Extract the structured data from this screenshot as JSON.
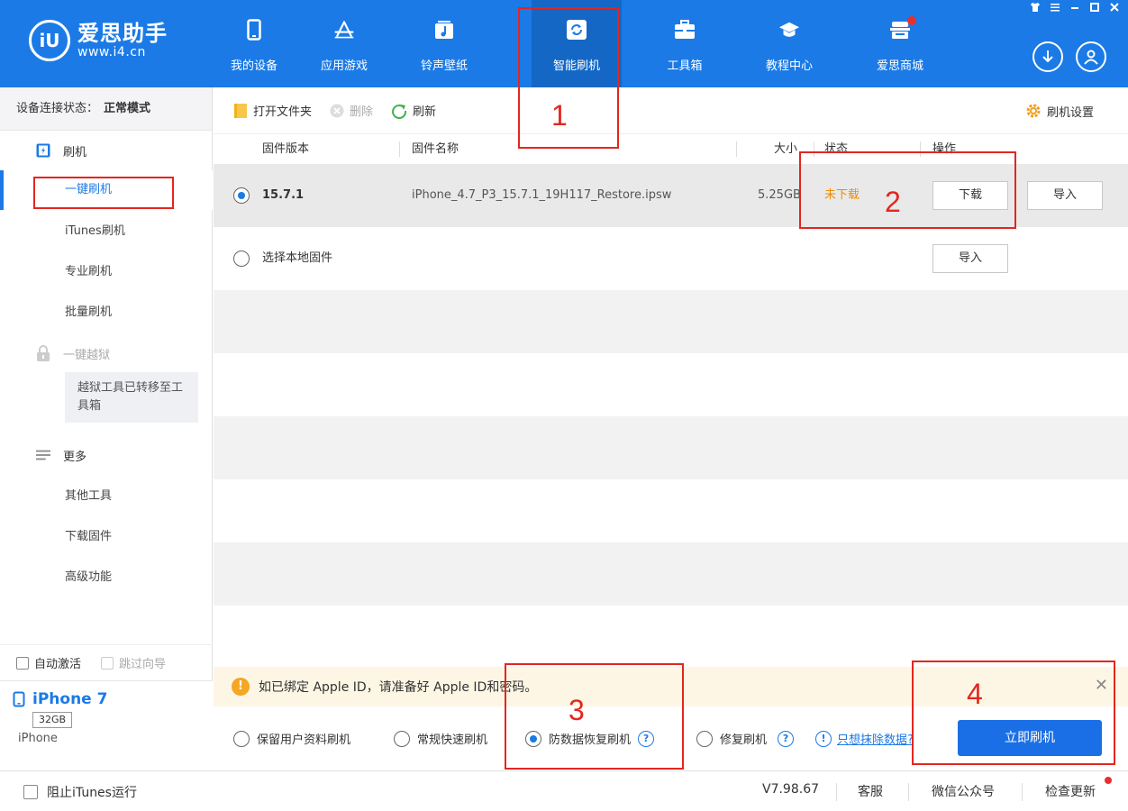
{
  "app": {
    "logo_mark": "iU",
    "logo_name": "爱思助手",
    "logo_url": "www.i4.cn"
  },
  "nav": {
    "items": [
      {
        "label": "我的设备",
        "icon": "phone-icon"
      },
      {
        "label": "应用游戏",
        "icon": "appstore-icon"
      },
      {
        "label": "铃声壁纸",
        "icon": "music-icon"
      },
      {
        "label": "智能刷机",
        "icon": "refresh-icon",
        "active": true
      },
      {
        "label": "工具箱",
        "icon": "toolbox-icon"
      },
      {
        "label": "教程中心",
        "icon": "graduation-cap-icon"
      },
      {
        "label": "爱思商城",
        "icon": "store-icon"
      }
    ]
  },
  "window_controls": [
    "shirt-icon",
    "menu-icon",
    "minimize-icon",
    "maximize-icon",
    "close-icon"
  ],
  "sidebar": {
    "conn_label": "设备连接状态：",
    "conn_value": "正常模式",
    "flash_section": "刷机",
    "flash_items": [
      "一键刷机",
      "iTunes刷机",
      "专业刷机",
      "批量刷机"
    ],
    "jailbreak_section": "一键越狱",
    "jailbreak_notice": "越狱工具已转移至工具箱",
    "more_section": "更多",
    "more_items": [
      "其他工具",
      "下载固件",
      "高级功能"
    ],
    "auto_activate": "自动激活",
    "skip_guide": "跳过向导"
  },
  "device": {
    "name": "iPhone 7",
    "capacity": "32GB",
    "model": "iPhone"
  },
  "toolbar": {
    "open_folder": "打开文件夹",
    "delete": "删除",
    "refresh": "刷新",
    "settings": "刷机设置"
  },
  "table": {
    "headers": {
      "version": "固件版本",
      "name": "固件名称",
      "size": "大小",
      "status": "状态",
      "action": "操作"
    },
    "rows": [
      {
        "version": "15.7.1",
        "name": "iPhone_4.7_P3_15.7.1_19H117_Restore.ipsw",
        "size": "5.25GB",
        "status": "未下载",
        "download_label": "下载",
        "import_label": "导入"
      }
    ],
    "local_row": {
      "label": "选择本地固件",
      "import_label": "导入"
    }
  },
  "notice": {
    "text": "如已绑定 Apple ID，请准备好 Apple ID和密码。"
  },
  "modes": {
    "options": [
      "保留用户资料刷机",
      "常规快速刷机",
      "防数据恢复刷机",
      "修复刷机"
    ],
    "selected_index": 2,
    "erase_link": "只想抹除数据?",
    "flash_now": "立即刷机"
  },
  "statusbar": {
    "stop_itunes": "阻止iTunes运行",
    "version": "V7.98.67",
    "support": "客服",
    "wechat": "微信公众号",
    "check_update": "检查更新"
  },
  "annotations": [
    "1",
    "2",
    "3",
    "4"
  ],
  "colors": {
    "primary": "#1b7ae6",
    "warning": "#f5a623",
    "status_pending": "#f08c00",
    "annotation": "#e3261f"
  }
}
